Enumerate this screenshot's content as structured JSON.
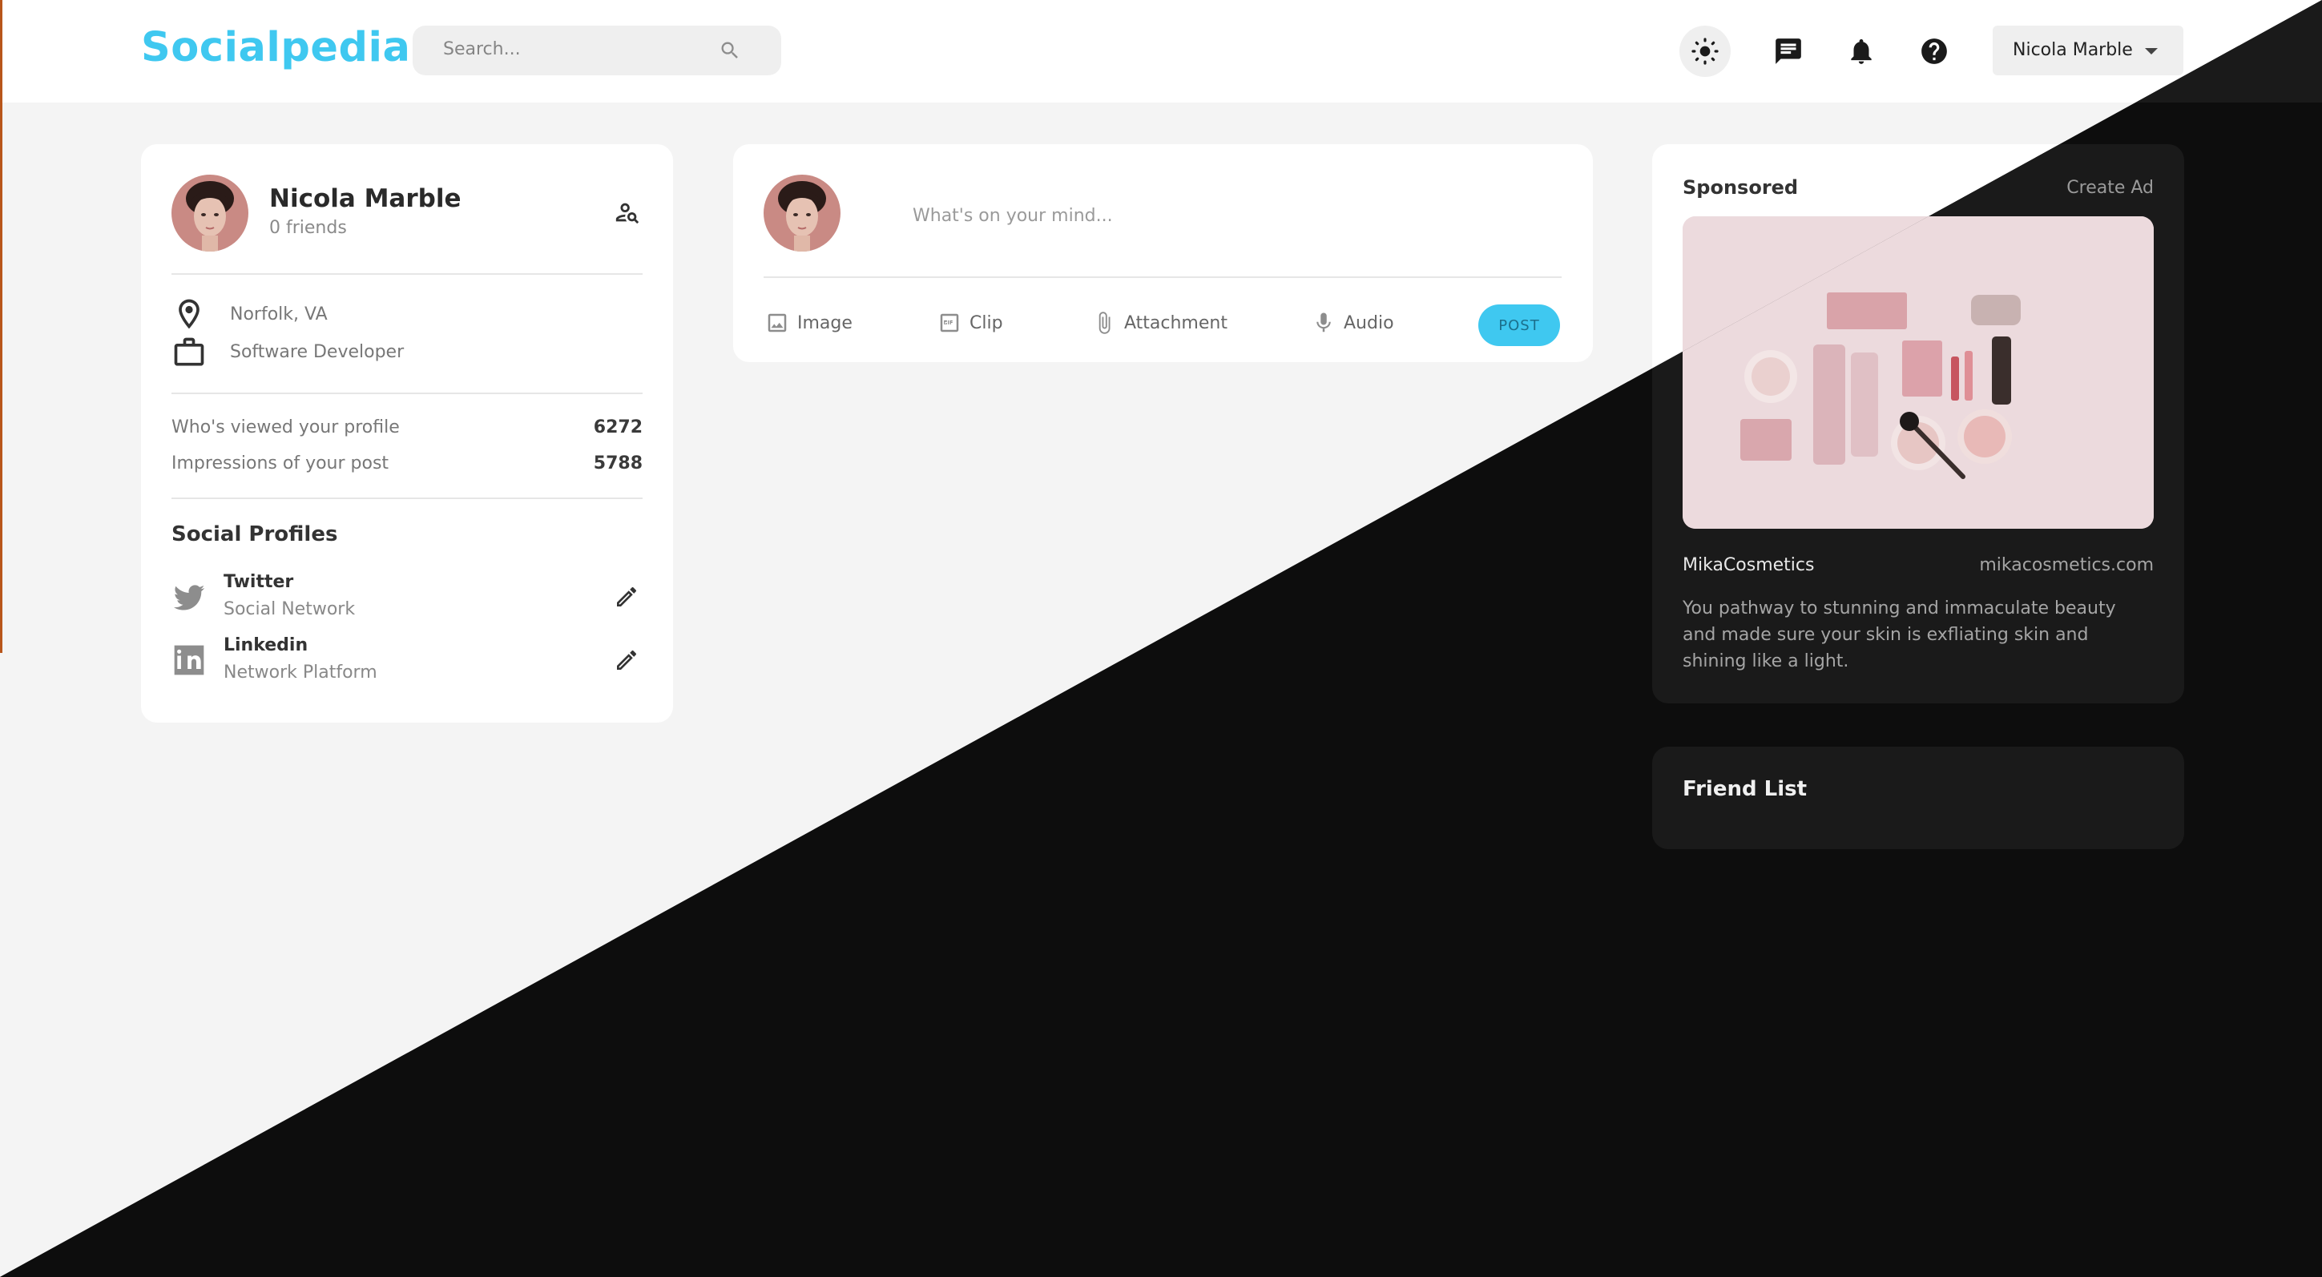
{
  "navbar": {
    "logo": "Socialpedia",
    "search_placeholder": "Search...",
    "user_name": "Nicola Marble",
    "icons": [
      "sun-icon",
      "message-icon",
      "bell-icon",
      "help-icon"
    ]
  },
  "profile": {
    "name": "Nicola Marble",
    "friends": "0 friends",
    "location": "Norfolk, VA",
    "occupation": "Software Developer",
    "stats": [
      {
        "label": "Who's viewed your profile",
        "value": "6272"
      },
      {
        "label": "Impressions of your post",
        "value": "5788"
      }
    ],
    "social_title": "Social Profiles",
    "socials": [
      {
        "name": "Twitter",
        "type": "Social Network",
        "icon": "twitter-icon"
      },
      {
        "name": "Linkedin",
        "type": "Network Platform",
        "icon": "linkedin-icon"
      }
    ]
  },
  "composer": {
    "placeholder": "What's on your mind...",
    "actions": [
      {
        "label": "Image",
        "icon": "image-icon"
      },
      {
        "label": "Clip",
        "icon": "gif-icon"
      },
      {
        "label": "Attachment",
        "icon": "paperclip-icon"
      },
      {
        "label": "Audio",
        "icon": "microphone-icon"
      }
    ],
    "post_label": "POST"
  },
  "sponsored": {
    "title": "Sponsored",
    "create_label": "Create Ad",
    "brand": "MikaCosmetics",
    "site": "mikacosmetics.com",
    "description": "You pathway to stunning and immaculate beauty and made sure your skin is exfliating skin and shining like a light."
  },
  "friend_list": {
    "title": "Friend List"
  },
  "theme": {
    "accent": "#3fc8f0",
    "light_bg": "#f4f4f4",
    "dark_bg": "#0d0d0d"
  }
}
